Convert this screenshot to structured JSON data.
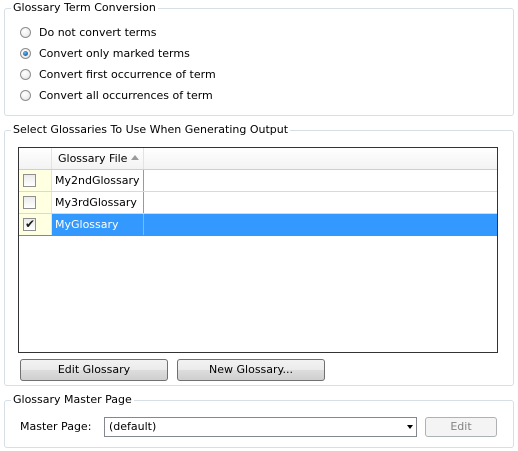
{
  "term_conversion": {
    "legend": "Glossary Term Conversion",
    "options": [
      {
        "label": "Do not convert terms",
        "checked": false
      },
      {
        "label": "Convert only marked terms",
        "checked": true
      },
      {
        "label": "Convert first occurrence of term",
        "checked": false
      },
      {
        "label": "Convert all occurrences of term",
        "checked": false
      }
    ]
  },
  "glossaries": {
    "legend": "Select Glossaries To Use When Generating Output",
    "column_header": "Glossary File",
    "sort": "ascending",
    "rows": [
      {
        "name": "My2ndGlossary",
        "checked": false,
        "selected": false
      },
      {
        "name": "My3rdGlossary",
        "checked": false,
        "selected": false
      },
      {
        "name": "MyGlossary",
        "checked": true,
        "selected": true
      }
    ],
    "edit_button": "Edit Glossary",
    "new_button": "New Glossary..."
  },
  "master_page": {
    "legend": "Glossary Master Page",
    "label": "Master Page:",
    "value": "(default)",
    "edit_button": "Edit"
  },
  "colors": {
    "selection": "#3399ff",
    "check_column": "#ffffe1",
    "group_border": "#d5dfe5",
    "radio_dot": "#1f6eb3"
  }
}
